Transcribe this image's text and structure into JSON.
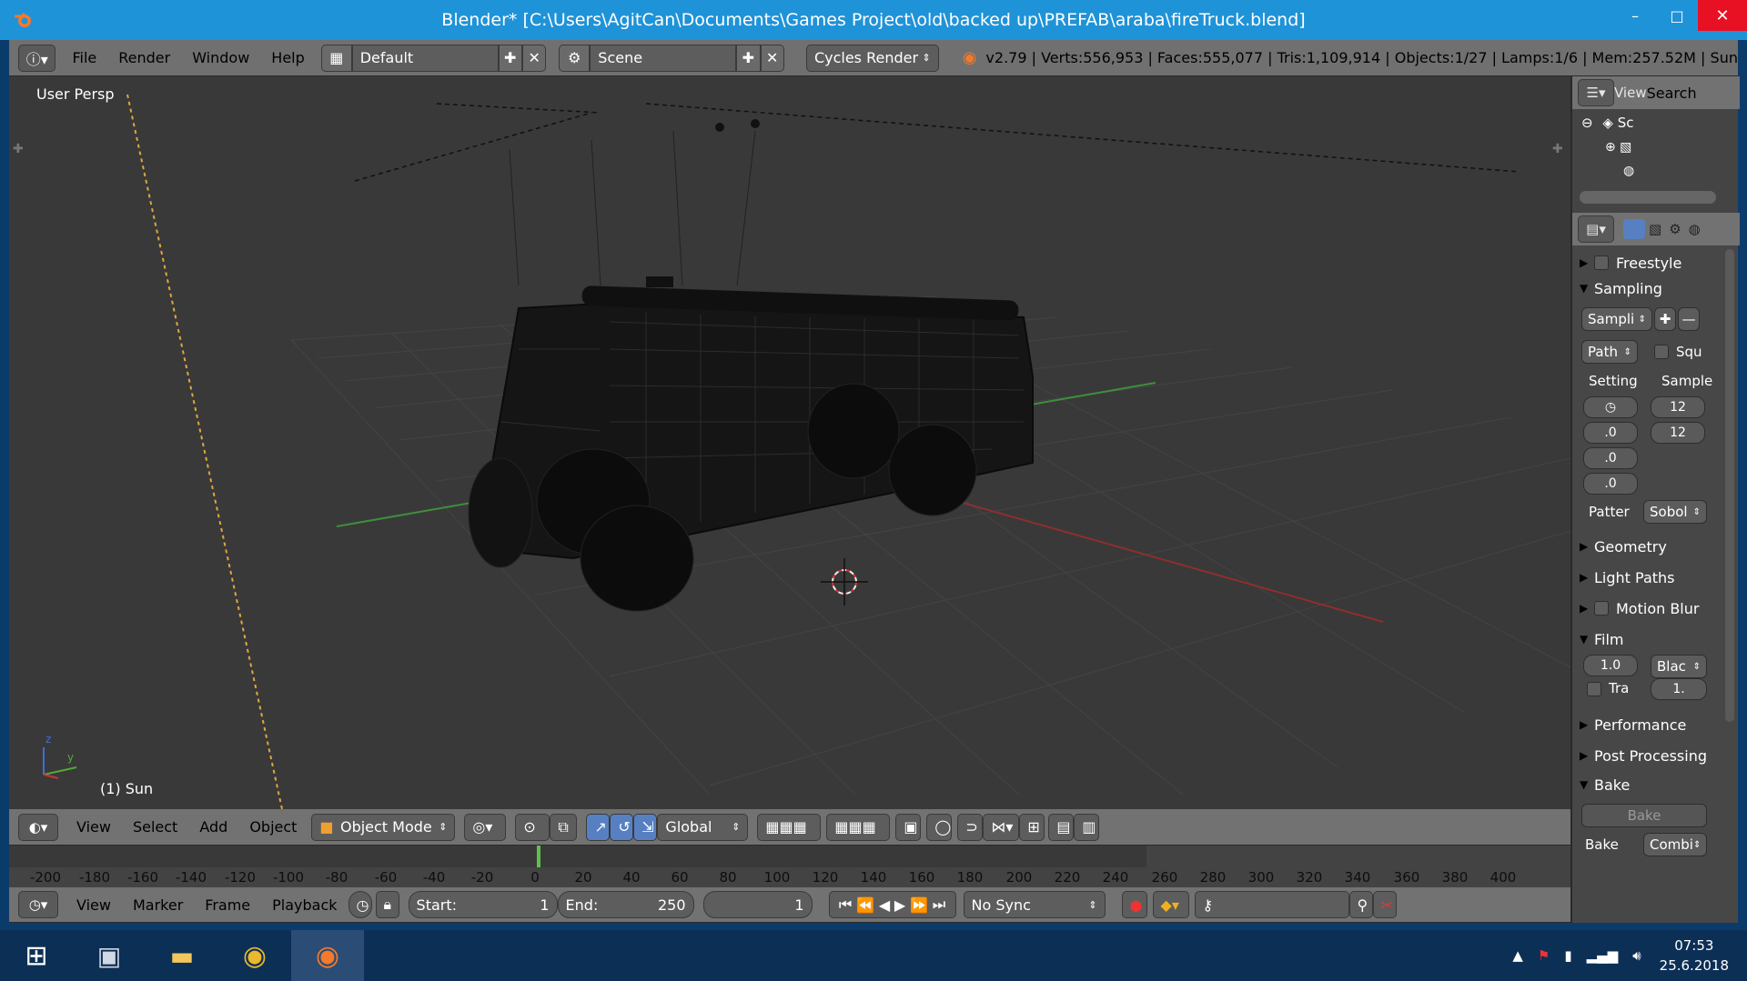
{
  "window": {
    "title": "Blender* [C:\\Users\\AgitCan\\Documents\\Games Project\\old\\backed up\\PREFAB\\araba\\fireTruck.blend]",
    "minimize": "–",
    "maximize": "□",
    "close": "✕"
  },
  "info_header": {
    "menus": [
      "File",
      "Render",
      "Window",
      "Help"
    ],
    "layout": "Default",
    "scene": "Scene",
    "engine": "Cycles Render",
    "stats": "v2.79 | Verts:556,953 | Faces:555,077 | Tris:1,109,914 | Objects:1/27 | Lamps:1/6 | Mem:257.52M | Sun"
  },
  "viewport": {
    "view_label": "User Persp",
    "object_label": "(1) Sun",
    "axis_x": "y",
    "axis_z": "z"
  },
  "viewport_header": {
    "menus": [
      "View",
      "Select",
      "Add",
      "Object"
    ],
    "mode": "Object Mode",
    "orientation": "Global"
  },
  "timeline": {
    "ticks": [
      "-200",
      "-180",
      "-160",
      "-140",
      "-120",
      "-100",
      "-80",
      "-60",
      "-40",
      "-20",
      "0",
      "20",
      "40",
      "60",
      "80",
      "100",
      "120",
      "140",
      "160",
      "180",
      "200",
      "220",
      "240",
      "260",
      "280",
      "300",
      "320",
      "340",
      "360",
      "380",
      "400"
    ],
    "menus": [
      "View",
      "Marker",
      "Frame",
      "Playback"
    ],
    "start_label": "Start:",
    "start": "1",
    "end_label": "End:",
    "end": "250",
    "current": "1",
    "sync": "No Sync"
  },
  "outliner": {
    "view": "View",
    "search": "Search",
    "scene_item": "Sc"
  },
  "properties": {
    "panels": {
      "freestyle": "Freestyle",
      "sampling": "Sampling",
      "geometry": "Geometry",
      "light_paths": "Light Paths",
      "motion_blur": "Motion Blur",
      "film": "Film",
      "performance": "Performance",
      "post_processing": "Post Processing",
      "bake": "Bake"
    },
    "sampling": {
      "preset": "Sampli",
      "integrator": "Path",
      "square": "Squ",
      "settings_col": "Setting",
      "samples_col": "Sample",
      "render_samples": "12",
      "preview_samples": "12",
      "set1": ".0",
      "set2": ".0",
      "set3": ".0",
      "pattern_label": "Patter",
      "pattern": "Sobol"
    },
    "film": {
      "exposure": "1.0",
      "filter": "Blac",
      "width": "1.",
      "transparent": "Tra"
    },
    "bake": {
      "button": "Bake",
      "label": "Bake",
      "type": "Combi"
    }
  },
  "taskbar": {
    "time": "07:53",
    "date": "25.6.2018"
  }
}
